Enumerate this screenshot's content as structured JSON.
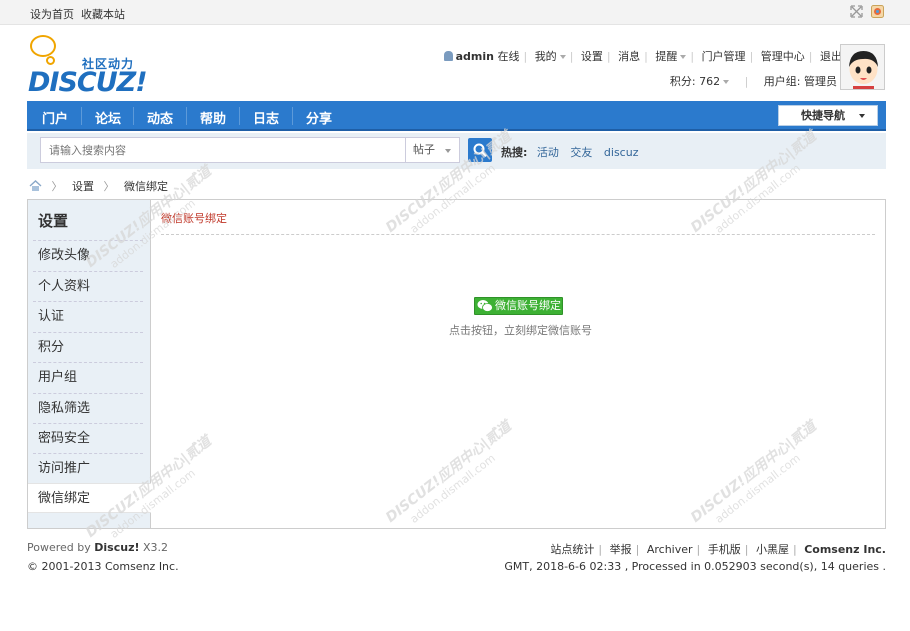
{
  "topbar": {
    "set_home": "设为首页",
    "bookmark": "收藏本站"
  },
  "logo": {
    "cn": "社区动力",
    "en": "DISCUZ!"
  },
  "user": {
    "name": "admin",
    "online": "在线",
    "mine": "我的",
    "settings": "设置",
    "messages": "消息",
    "remind": "提醒",
    "portal_admin": "门户管理",
    "admin_center": "管理中心",
    "logout": "退出",
    "points": "积分: 762",
    "group": "用户组: 管理员"
  },
  "nav": {
    "items": [
      "门户",
      "论坛",
      "动态",
      "帮助",
      "日志",
      "分享"
    ],
    "quick": "快捷导航"
  },
  "search": {
    "placeholder": "请输入搜索内容",
    "type": "帖子",
    "hot_label": "热搜:",
    "hot": [
      "活动",
      "交友",
      "discuz"
    ]
  },
  "breadcrumb": [
    "设置",
    "微信绑定"
  ],
  "sidebar": {
    "title": "设置",
    "items": [
      "修改头像",
      "个人资料",
      "认证",
      "积分",
      "用户组",
      "隐私筛选",
      "密码安全",
      "访问推广",
      "微信绑定"
    ],
    "active_index": 8
  },
  "main": {
    "title": "微信账号绑定",
    "button": "微信账号绑定",
    "hint": "点击按钮，立刻绑定微信账号"
  },
  "footer": {
    "powered": "Powered by",
    "product": "Discuz!",
    "version": "X3.2",
    "copyright": "© 2001-2013 Comsenz Inc.",
    "links": [
      "站点统计",
      "举报",
      "Archiver",
      "手机版",
      "小黑屋"
    ],
    "company": "Comsenz Inc.",
    "status": "GMT, 2018-6-6 02:33 , Processed in 0.052903 second(s), 14 queries ."
  },
  "watermark": {
    "line1": "DISCUZ!应用中心|贰道",
    "line2": "addon.dismall.com"
  },
  "colors": {
    "nav": "#2b7acd",
    "wechat_button": "#3db134",
    "title_red": "#c0392b"
  }
}
